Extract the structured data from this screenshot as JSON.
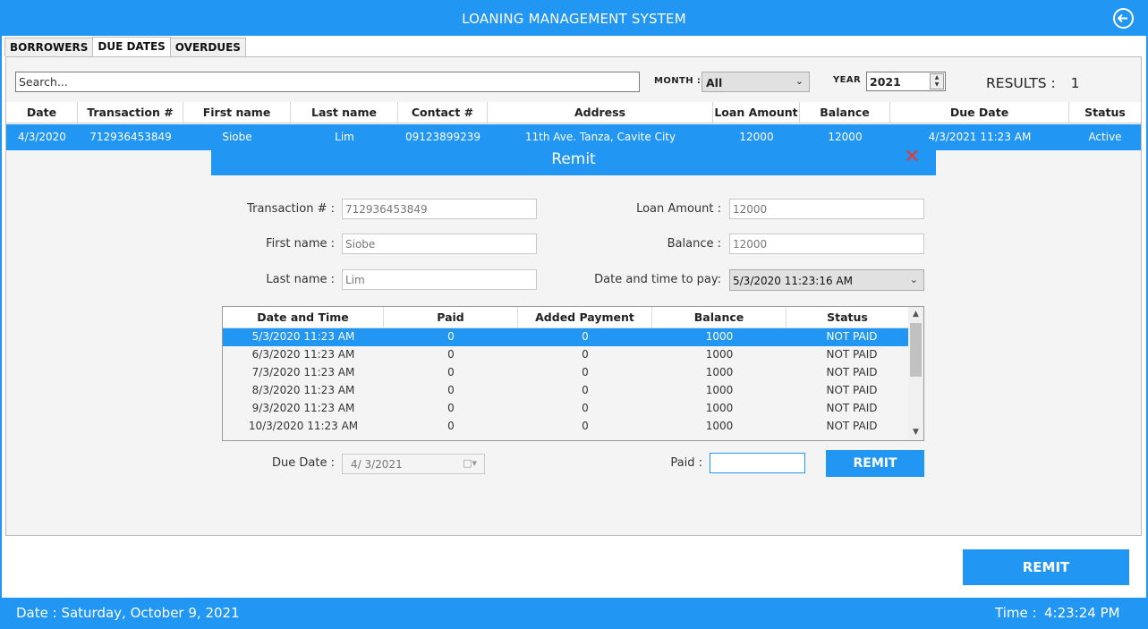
{
  "app": {
    "title": "LOANING MANAGEMENT SYSTEM"
  },
  "tabs": [
    "BORROWERS",
    "DUE DATES",
    "OVERDUES"
  ],
  "filters": {
    "search_placeholder": "Search...",
    "month_label": "MONTH :",
    "month_value": "All",
    "year_label": "YEAR",
    "year_value": "2021",
    "results_label": "RESULTS :",
    "results_count": "1"
  },
  "grid": {
    "columns": [
      "Date",
      "Transaction #",
      "First name",
      "Last name",
      "Contact #",
      "Address",
      "Loan Amount",
      "Balance",
      "Due Date",
      "Status"
    ],
    "rows": [
      [
        "4/3/2020",
        "712936453849",
        "Siobe",
        "Lim",
        "09123899239",
        "11th Ave. Tanza, Cavite City",
        "12000",
        "12000",
        "4/3/2021 11:23 AM",
        "Active"
      ]
    ]
  },
  "dialog": {
    "title": "Remit",
    "fields": {
      "transaction_label": "Transaction # :",
      "transaction_value": "712936453849",
      "first_name_label": "First name :",
      "first_name_value": "Siobe",
      "last_name_label": "Last name :",
      "last_name_value": "Lim",
      "loan_amount_label": "Loan Amount :",
      "loan_amount_value": "12000",
      "balance_label": "Balance :",
      "balance_value": "12000",
      "date_to_pay_label": "Date and time to pay:",
      "date_to_pay_value": "5/3/2020 11:23:16 AM"
    },
    "schedule": {
      "columns": [
        "Date and Time",
        "Paid",
        "Added Payment",
        "Balance",
        "Status"
      ],
      "rows": [
        [
          "5/3/2020 11:23 AM",
          "0",
          "0",
          "1000",
          "NOT PAID"
        ],
        [
          "6/3/2020 11:23 AM",
          "0",
          "0",
          "1000",
          "NOT PAID"
        ],
        [
          "7/3/2020 11:23 AM",
          "0",
          "0",
          "1000",
          "NOT PAID"
        ],
        [
          "8/3/2020 11:23 AM",
          "0",
          "0",
          "1000",
          "NOT PAID"
        ],
        [
          "9/3/2020 11:23 AM",
          "0",
          "0",
          "1000",
          "NOT PAID"
        ],
        [
          "10/3/2020 11:23 AM",
          "0",
          "0",
          "1000",
          "NOT PAID"
        ]
      ]
    },
    "due_date_label": "Due Date :",
    "due_date_value": "4/  3/2021",
    "paid_label": "Paid :",
    "paid_value": "",
    "remit_button": "REMIT"
  },
  "main_remit_button": "REMIT",
  "status": {
    "date_text": "Date : Saturday, October 9, 2021",
    "time_label": "Time :",
    "time_value": "4:23:24 PM"
  },
  "colors": {
    "accent": "#2196f3",
    "close": "#e53935"
  }
}
